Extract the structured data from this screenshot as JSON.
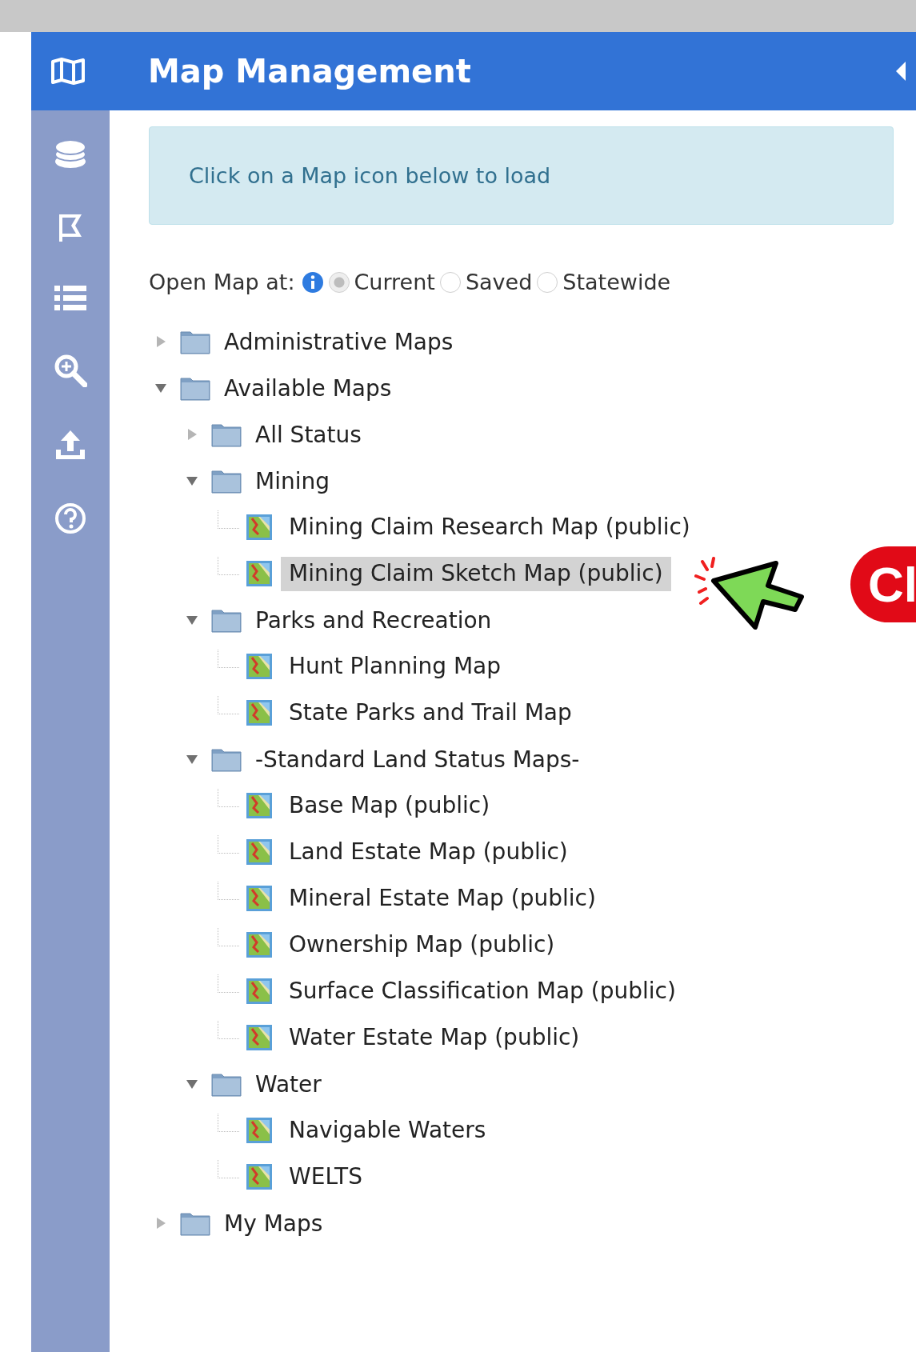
{
  "panel": {
    "title": "Map Management"
  },
  "alert": {
    "text": "Click on a Map icon below to load"
  },
  "open_map_at": {
    "label": "Open Map at:",
    "options": [
      {
        "label": "Current",
        "selected": true
      },
      {
        "label": "Saved",
        "selected": false
      },
      {
        "label": "Statewide",
        "selected": false
      }
    ]
  },
  "tree": [
    {
      "kind": "folder",
      "label": "Administrative Maps",
      "expanded": false
    },
    {
      "kind": "folder",
      "label": "Available Maps",
      "expanded": true,
      "children": [
        {
          "kind": "folder",
          "label": "All Status",
          "expanded": false
        },
        {
          "kind": "folder",
          "label": "Mining",
          "expanded": true,
          "children": [
            {
              "kind": "map",
              "label": "Mining Claim Research Map (public)",
              "selected": false
            },
            {
              "kind": "map",
              "label": "Mining Claim Sketch Map (public)",
              "selected": true
            }
          ]
        },
        {
          "kind": "folder",
          "label": "Parks and Recreation",
          "expanded": true,
          "children": [
            {
              "kind": "map",
              "label": "Hunt Planning Map",
              "selected": false
            },
            {
              "kind": "map",
              "label": "State Parks and Trail Map",
              "selected": false
            }
          ]
        },
        {
          "kind": "folder",
          "label": "-Standard Land Status Maps-",
          "expanded": true,
          "children": [
            {
              "kind": "map",
              "label": "Base Map (public)",
              "selected": false
            },
            {
              "kind": "map",
              "label": "Land Estate Map (public)",
              "selected": false
            },
            {
              "kind": "map",
              "label": "Mineral Estate Map (public)",
              "selected": false
            },
            {
              "kind": "map",
              "label": "Ownership Map (public)",
              "selected": false
            },
            {
              "kind": "map",
              "label": "Surface Classification Map (public)",
              "selected": false
            },
            {
              "kind": "map",
              "label": "Water Estate Map (public)",
              "selected": false
            }
          ]
        },
        {
          "kind": "folder",
          "label": "Water",
          "expanded": true,
          "children": [
            {
              "kind": "map",
              "label": "Navigable Waters",
              "selected": false
            },
            {
              "kind": "map",
              "label": "WELTS",
              "selected": false
            }
          ]
        }
      ]
    },
    {
      "kind": "folder",
      "label": "My Maps",
      "expanded": false
    }
  ],
  "callout": {
    "text": "Cl"
  }
}
